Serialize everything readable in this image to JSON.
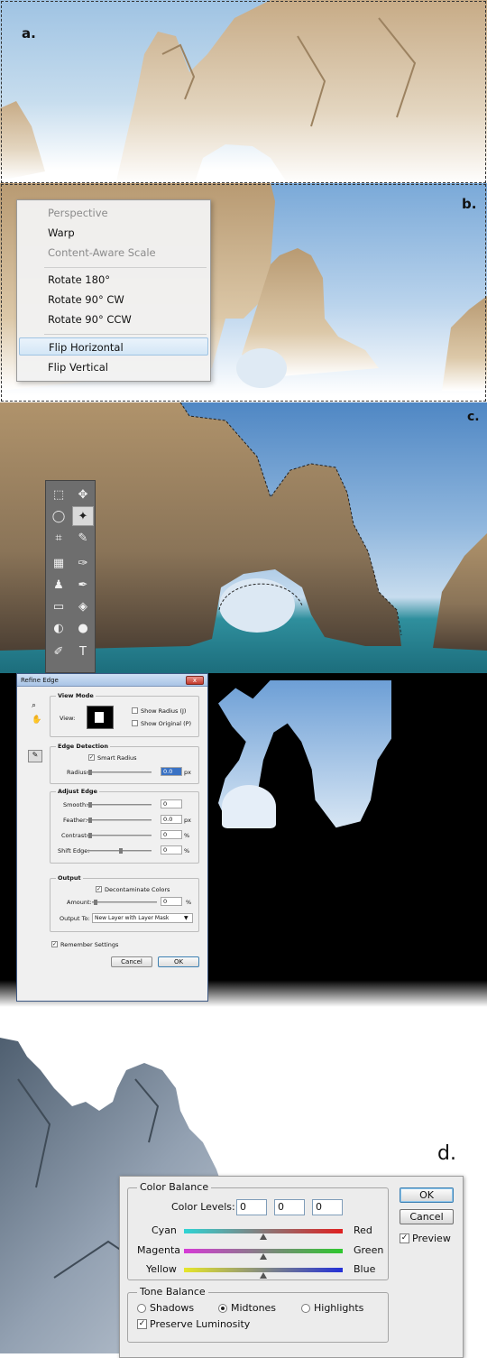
{
  "panels": {
    "a": {
      "label": "a."
    },
    "b": {
      "label": "b.",
      "menu": {
        "items": [
          {
            "label": "Perspective",
            "disabled": true
          },
          {
            "label": "Warp",
            "disabled": false
          },
          {
            "label": "Content-Aware Scale",
            "disabled": true
          },
          {
            "label": "Rotate 180°",
            "disabled": false
          },
          {
            "label": "Rotate 90° CW",
            "disabled": false
          },
          {
            "label": "Rotate 90° CCW",
            "disabled": false
          },
          {
            "label": "Flip Horizontal",
            "disabled": false,
            "highlighted": true
          },
          {
            "label": "Flip Vertical",
            "disabled": false
          }
        ]
      }
    },
    "c": {
      "label": "c."
    },
    "d": {
      "label": "d."
    }
  },
  "refine_edge": {
    "title": "Refine Edge",
    "close": "x",
    "view_mode": {
      "title": "View Mode",
      "view_label": "View:",
      "show_radius": "Show Radius (J)",
      "show_original": "Show Original (P)"
    },
    "edge_detection": {
      "title": "Edge Detection",
      "smart_radius": "Smart Radius",
      "radius_label": "Radius:",
      "radius_value": "0.0",
      "radius_unit": "px"
    },
    "adjust_edge": {
      "title": "Adjust Edge",
      "smooth_label": "Smooth:",
      "smooth_value": "0",
      "feather_label": "Feather:",
      "feather_value": "0.0",
      "feather_unit": "px",
      "contrast_label": "Contrast:",
      "contrast_value": "0",
      "contrast_unit": "%",
      "shift_label": "Shift Edge:",
      "shift_value": "0",
      "shift_unit": "%"
    },
    "output": {
      "title": "Output",
      "decontaminate": "Decontaminate Colors",
      "amount_label": "Amount:",
      "amount_value": "0",
      "amount_unit": "%",
      "output_to_label": "Output To:",
      "output_to_value": "New Layer with Layer Mask"
    },
    "remember": "Remember Settings",
    "cancel": "Cancel",
    "ok": "OK"
  },
  "color_balance": {
    "group_title": "Color Balance",
    "levels_label": "Color Levels:",
    "levels": [
      "0",
      "0",
      "0"
    ],
    "sliders": [
      {
        "left": "Cyan",
        "right": "Red",
        "from": "#2fd4d4",
        "to": "#e02020"
      },
      {
        "left": "Magenta",
        "right": "Green",
        "from": "#d63ad6",
        "to": "#2ec82e"
      },
      {
        "left": "Yellow",
        "right": "Blue",
        "from": "#e6e62a",
        "to": "#2430d8"
      }
    ],
    "tone_title": "Tone Balance",
    "shadows": "Shadows",
    "midtones": "Midtones",
    "highlights": "Highlights",
    "preserve": "Preserve Luminosity",
    "ok": "OK",
    "cancel": "Cancel",
    "preview": "Preview"
  }
}
